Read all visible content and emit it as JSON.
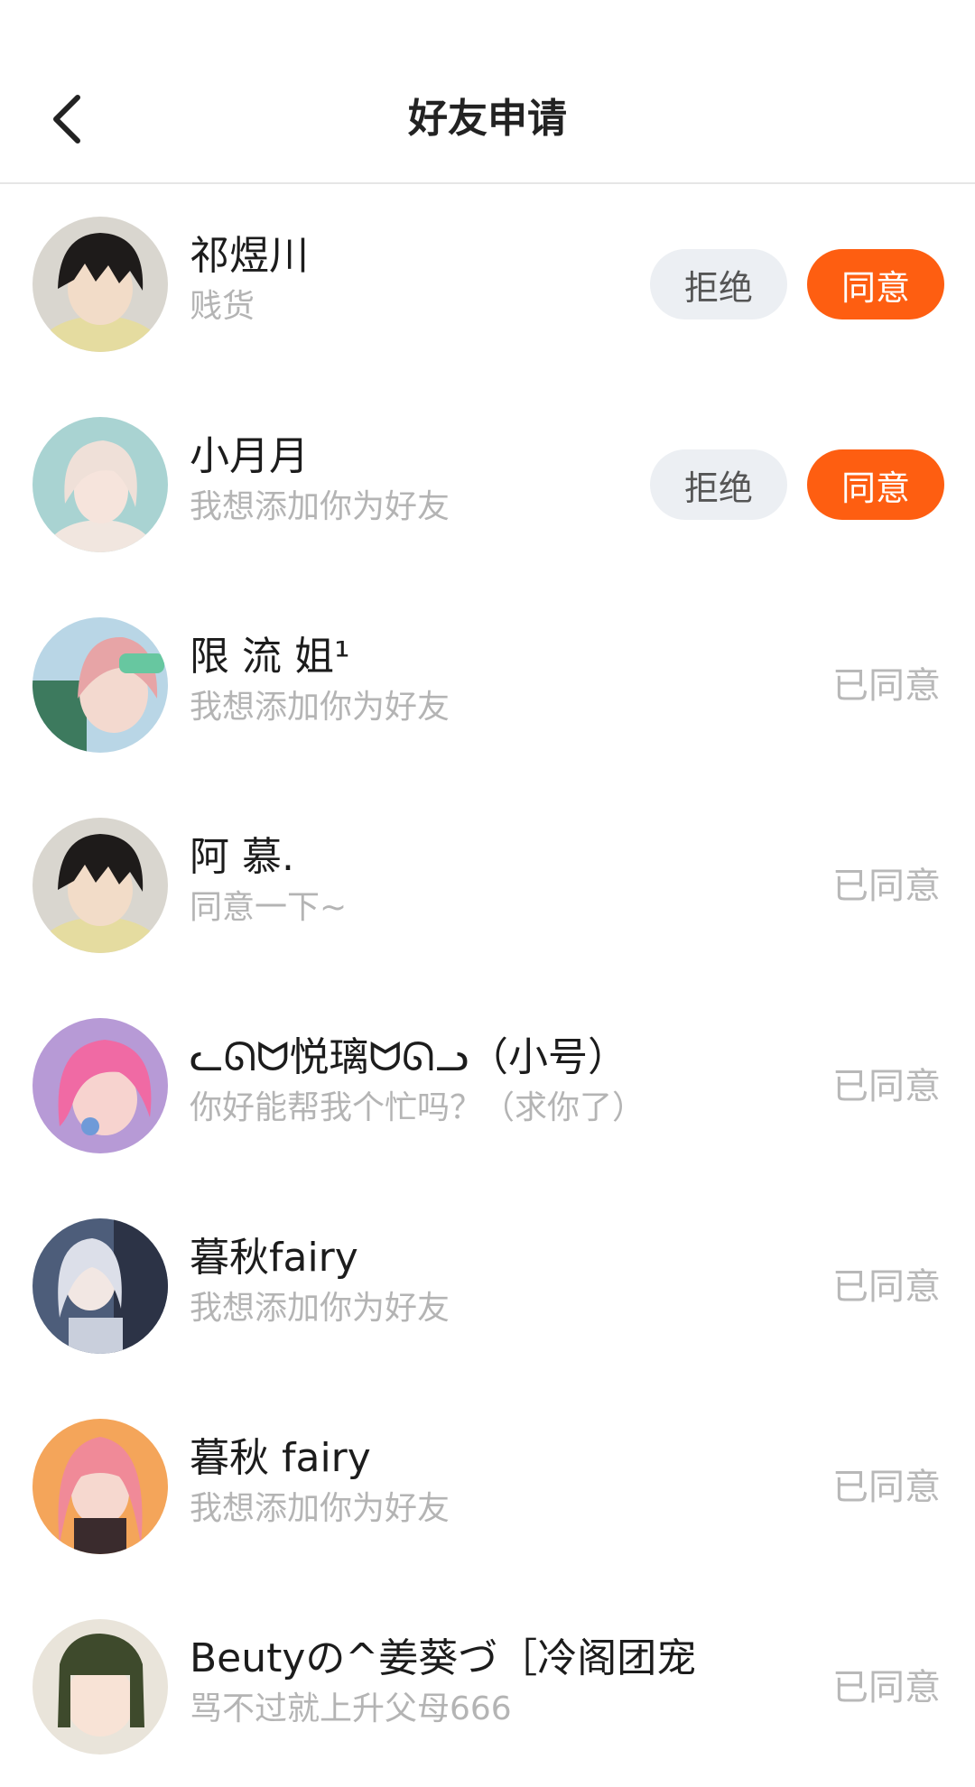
{
  "header": {
    "title": "好友申请",
    "back_icon": "chevron-left-icon"
  },
  "colors": {
    "accent": "#fe5e11",
    "reject_bg": "#eceff3",
    "muted": "#b4b4b4"
  },
  "requests": [
    {
      "name": "祁煜川",
      "message": "贱货",
      "status": "pending",
      "reject_label": "拒绝",
      "accept_label": "同意"
    },
    {
      "name": "小月月",
      "message": "我想添加你为好友",
      "status": "pending",
      "reject_label": "拒绝",
      "accept_label": "同意"
    },
    {
      "name": "限 流 姐¹",
      "message": "我想添加你为好友",
      "status": "已同意"
    },
    {
      "name": "阿 慕.",
      "message": "同意一下~",
      "status": "已同意"
    },
    {
      "name": "ᓚᘏᗢ悦璃ᗢᘏᓗ（小号）",
      "message": "你好能帮我个忙吗？（求你了）",
      "status": "已同意"
    },
    {
      "name": "暮秋fairy",
      "message": "我想添加你为好友",
      "status": "已同意"
    },
    {
      "name": "暮秋 fairy",
      "message": "我想添加你为好友",
      "status": "已同意"
    },
    {
      "name": "Beutyの^姜葵づ［冷阁团宠｝",
      "message": "骂不过就上升父母666",
      "status": "已同意"
    }
  ]
}
